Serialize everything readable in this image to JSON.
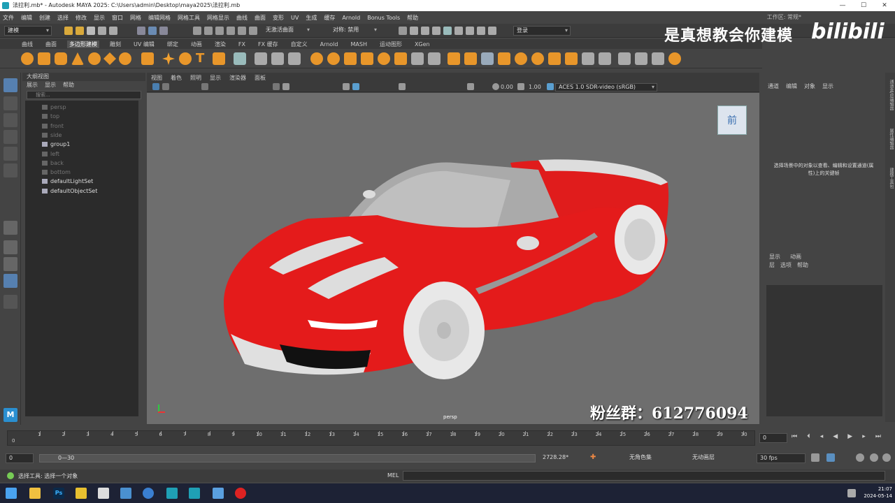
{
  "title_bar": {
    "title": "法拉利.mb* - Autodesk MAYA 2025: C:\\Users\\admin\\Desktop\\maya2025\\法拉利.mb",
    "controls": [
      "—",
      "☐",
      "✕"
    ]
  },
  "menu_bar": {
    "items": [
      "文件",
      "编辑",
      "创建",
      "选择",
      "修改",
      "显示",
      "窗口",
      "网格",
      "编辑网格",
      "网格工具",
      "网格显示",
      "曲线",
      "曲面",
      "变形",
      "UV",
      "生成",
      "缓存",
      "Arnold",
      "Bonus Tools",
      "帮助"
    ],
    "workspace_label": "工作区:",
    "workspace_value": "常规*"
  },
  "status_line": {
    "mode": "建模",
    "live_surface": "无激活曲面",
    "symmetry": "对称: 禁用",
    "login": "登录"
  },
  "watermark": {
    "text": "是真想教会你建模",
    "logo": "bilibili",
    "fans": "粉丝群：612776094"
  },
  "shelf": {
    "tabs": [
      "曲线",
      "曲面",
      "多边形建模",
      "雕刻",
      "UV 编辑",
      "绑定",
      "动画",
      "渲染",
      "FX",
      "FX 缓存",
      "自定义",
      "Arnold",
      "MASH",
      "运动图形",
      "XGen"
    ],
    "active_tab": "多边形建模"
  },
  "outliner": {
    "title": "大纲视图",
    "menu": [
      "展示",
      "显示",
      "帮助"
    ],
    "search_placeholder": "搜索...",
    "items": [
      {
        "label": "persp",
        "dim": true
      },
      {
        "label": "top",
        "dim": true
      },
      {
        "label": "front",
        "dim": true
      },
      {
        "label": "side",
        "dim": true
      },
      {
        "label": "group1",
        "dim": false
      },
      {
        "label": "left",
        "dim": true
      },
      {
        "label": "back",
        "dim": true
      },
      {
        "label": "bottom",
        "dim": true
      },
      {
        "label": "defaultLightSet",
        "dim": false
      },
      {
        "label": "defaultObjectSet",
        "dim": false
      }
    ]
  },
  "viewport": {
    "menu": [
      "视图",
      "着色",
      "照明",
      "显示",
      "渲染器",
      "面板"
    ],
    "value_a": "0.00",
    "value_b": "1.00",
    "color_space": "ACES 1.0 SDR-video (sRGB)",
    "camera_label": "persp",
    "view_cube_label": "前"
  },
  "channel_box": {
    "menu": [
      "通道",
      "编辑",
      "对象",
      "显示"
    ],
    "message": "选择场景中的对象以查看、编辑和设置通道(属性)上的关键帧"
  },
  "layer_editor": {
    "tabs": [
      "显示",
      "动画"
    ],
    "menu": [
      "层",
      "选项",
      "帮助"
    ]
  },
  "side_strip_labels": [
    "通道盒/层编辑器",
    "属性编辑器",
    "建模工具包"
  ],
  "timeline": {
    "ticks": [
      "1",
      "2",
      "3",
      "4",
      "5",
      "6",
      "7",
      "8",
      "9",
      "10",
      "11",
      "12",
      "13",
      "14",
      "15",
      "16",
      "17",
      "18",
      "19",
      "20",
      "21",
      "22",
      "23",
      "24",
      "25",
      "26",
      "27",
      "28",
      "29",
      "30"
    ],
    "start": "0",
    "current_frame": "0"
  },
  "range_bar": {
    "start": "0",
    "range_label": "0—30",
    "end_value": "2728.28*",
    "character_set": "无角色集",
    "anim_layer": "无动画层",
    "fps": "30 fps"
  },
  "command_line": {
    "help_text": "选择工具: 选择一个对象",
    "lang": "MEL"
  },
  "taskbar": {
    "time": "21:07",
    "date": "2024-05-14"
  }
}
